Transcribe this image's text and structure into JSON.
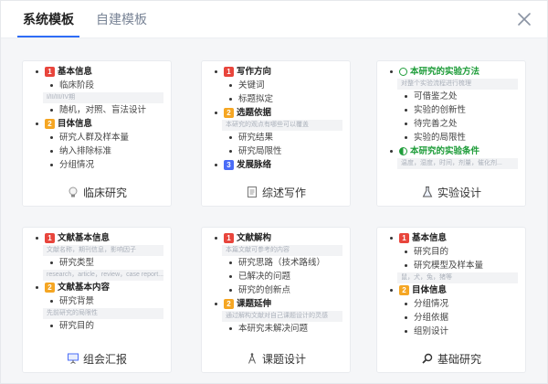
{
  "tabs": [
    {
      "label": "系统模板",
      "active": true
    },
    {
      "label": "自建模板",
      "active": false
    }
  ],
  "close_icon": "close-icon",
  "colors": {
    "accent": "#2e6cf6",
    "green": "#1f9d3a",
    "red_badge": "#e8453c",
    "orange_badge": "#f5a623",
    "blue_badge": "#4a6cf7"
  },
  "cards": [
    {
      "title": "临床研究",
      "icon": "lightbulb-icon",
      "lines": [
        {
          "type": "heading",
          "badge": "1",
          "color": "red",
          "text": "基本信息"
        },
        {
          "type": "item",
          "text": "临床阶段"
        },
        {
          "type": "note",
          "text": "I/II/III/IV期"
        },
        {
          "type": "item",
          "text": "随机，对照、盲法设计"
        },
        {
          "type": "heading",
          "badge": "2",
          "color": "orange",
          "text": "目体信息"
        },
        {
          "type": "item",
          "text": "研究人群及样本量"
        },
        {
          "type": "item",
          "text": "纳入排除标准"
        },
        {
          "type": "item",
          "text": "分组情况"
        }
      ]
    },
    {
      "title": "综述写作",
      "icon": "document-icon",
      "lines": [
        {
          "type": "heading",
          "badge": "1",
          "color": "red",
          "text": "写作方向"
        },
        {
          "type": "item",
          "text": "关键词"
        },
        {
          "type": "item",
          "text": "标题拟定"
        },
        {
          "type": "heading",
          "badge": "2",
          "color": "orange",
          "text": "选题依据"
        },
        {
          "type": "note",
          "text": "本研究的观点有哪些可以覆盖"
        },
        {
          "type": "item",
          "text": "研究结果"
        },
        {
          "type": "item",
          "text": "研究局限性"
        },
        {
          "type": "heading",
          "badge": "3",
          "color": "blue",
          "text": "发展脉络"
        }
      ]
    },
    {
      "title": "实验设计",
      "icon": "flask-icon",
      "lines": [
        {
          "type": "green-heading",
          "icon": "clock",
          "text": "本研究的实验方法"
        },
        {
          "type": "note",
          "text": "对整个实验流程进行梳理"
        },
        {
          "type": "item",
          "text": "可借鉴之处"
        },
        {
          "type": "item",
          "text": "实验的创新性"
        },
        {
          "type": "item",
          "text": "待完善之处"
        },
        {
          "type": "item",
          "text": "实验的局限性"
        },
        {
          "type": "green-heading",
          "icon": "half",
          "text": "本研究的实验条件"
        },
        {
          "type": "note",
          "text": "温度，湿度，时间，剂量，催化剂..."
        }
      ]
    },
    {
      "title": "组会汇报",
      "icon": "presentation-icon",
      "lines": [
        {
          "type": "heading",
          "badge": "1",
          "color": "red",
          "text": "文献基本信息"
        },
        {
          "type": "note",
          "text": "文献名称，期刊信息，影响因子"
        },
        {
          "type": "item",
          "text": "研究类型"
        },
        {
          "type": "note",
          "text": "research，article，review，case report..."
        },
        {
          "type": "heading",
          "badge": "2",
          "color": "orange",
          "text": "文献基本内容"
        },
        {
          "type": "item",
          "text": "研究背景"
        },
        {
          "type": "note",
          "text": "先前研究的局限性"
        },
        {
          "type": "item",
          "text": "研究目的"
        }
      ]
    },
    {
      "title": "课题设计",
      "icon": "compass-icon",
      "lines": [
        {
          "type": "heading",
          "badge": "1",
          "color": "red",
          "text": "文献解构"
        },
        {
          "type": "note",
          "text": "本篇文献可参考的内容"
        },
        {
          "type": "item",
          "text": "研究思路（技术路线）"
        },
        {
          "type": "item",
          "text": "已解决的问题"
        },
        {
          "type": "item",
          "text": "研究的创新点"
        },
        {
          "type": "heading",
          "badge": "2",
          "color": "orange",
          "text": "课题延伸"
        },
        {
          "type": "note",
          "text": "通过解构文献对自己课题设计的灵感"
        },
        {
          "type": "item",
          "text": "本研究未解决问题"
        }
      ]
    },
    {
      "title": "基础研究",
      "icon": "magnifier-icon",
      "lines": [
        {
          "type": "heading",
          "badge": "1",
          "color": "red",
          "text": "基本信息"
        },
        {
          "type": "item",
          "text": "研究目的"
        },
        {
          "type": "item",
          "text": "研究模型及样本量"
        },
        {
          "type": "note",
          "text": "鼠，犬，兔，猪等"
        },
        {
          "type": "heading",
          "badge": "2",
          "color": "orange",
          "text": "目体信息"
        },
        {
          "type": "item",
          "text": "分组情况"
        },
        {
          "type": "item",
          "text": "分组依据"
        },
        {
          "type": "item",
          "text": "组别设计"
        }
      ]
    }
  ]
}
